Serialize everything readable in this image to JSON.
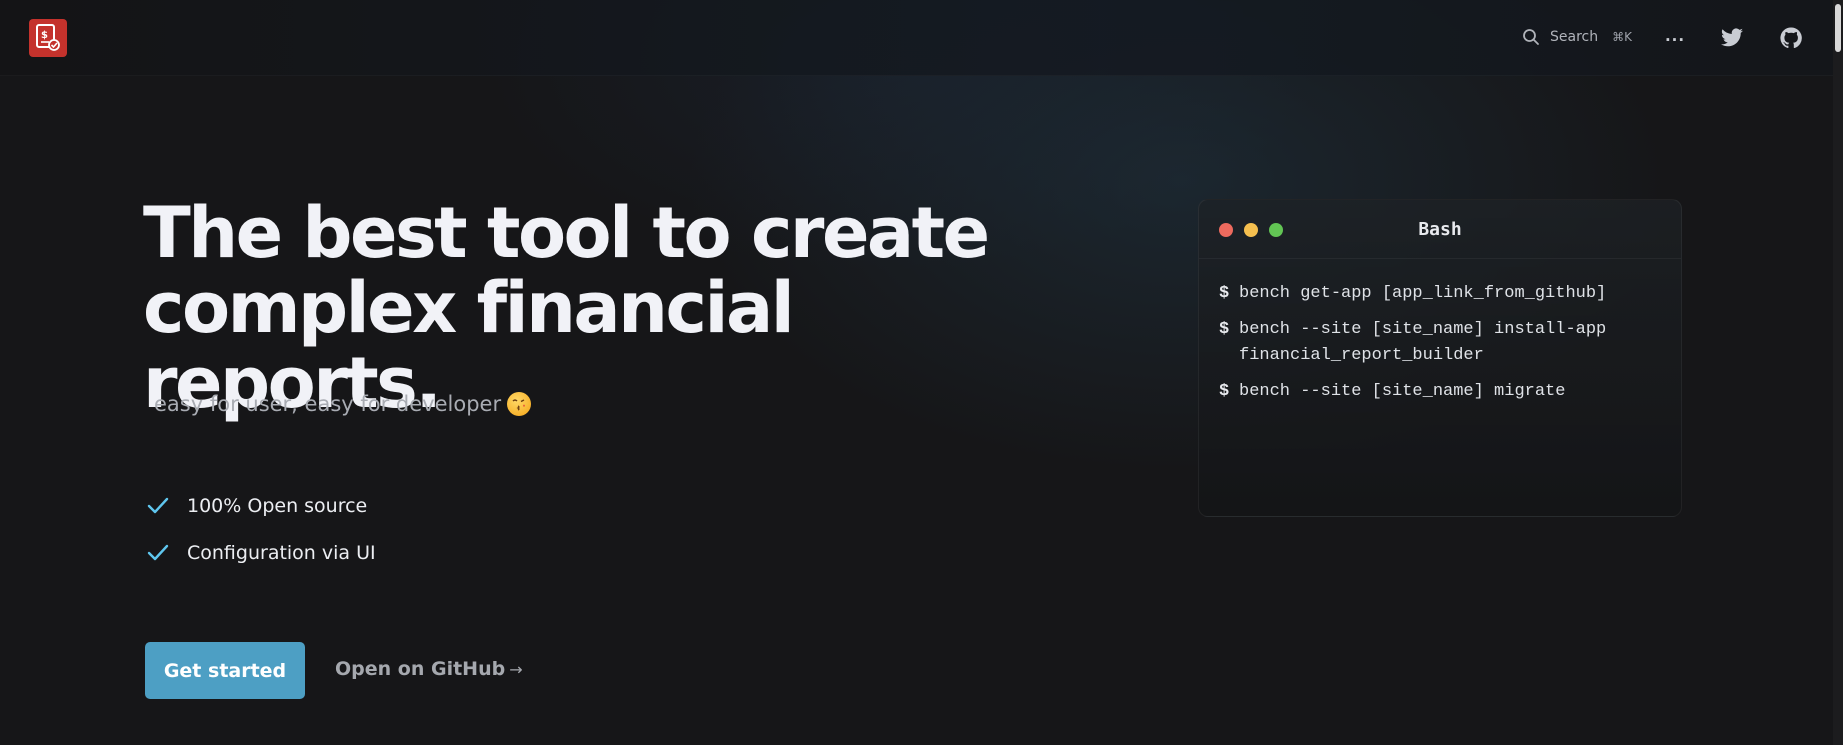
{
  "header": {
    "logo_name": "financial-report-icon",
    "search": {
      "label": "Search",
      "shortcut": "⌘K"
    },
    "more_label": "...",
    "colors": {
      "logo_bg": "#c4322c"
    }
  },
  "hero": {
    "title": "The best tool to create complex financial reports.",
    "subtitle": "easy for user, easy for developer",
    "features": [
      {
        "label": "100% Open source"
      },
      {
        "label": "Configuration via UI"
      }
    ],
    "primary_button": "Get started",
    "secondary_link": "Open on GitHub",
    "secondary_link_arrow": "→",
    "colors": {
      "accent": "#4d9fc4",
      "check": "#5fc6ee"
    }
  },
  "terminal": {
    "title": "Bash",
    "prompt": "$",
    "lines": [
      {
        "cmd": "bench get-app [app_link_from_github]"
      },
      {
        "cmd": "bench --site [site_name] install-app financial_report_builder"
      },
      {
        "cmd": "bench --site [site_name] migrate"
      }
    ],
    "colors": {
      "red": "#ed6a5e",
      "yellow": "#f5bf4f",
      "green": "#62c554"
    }
  }
}
